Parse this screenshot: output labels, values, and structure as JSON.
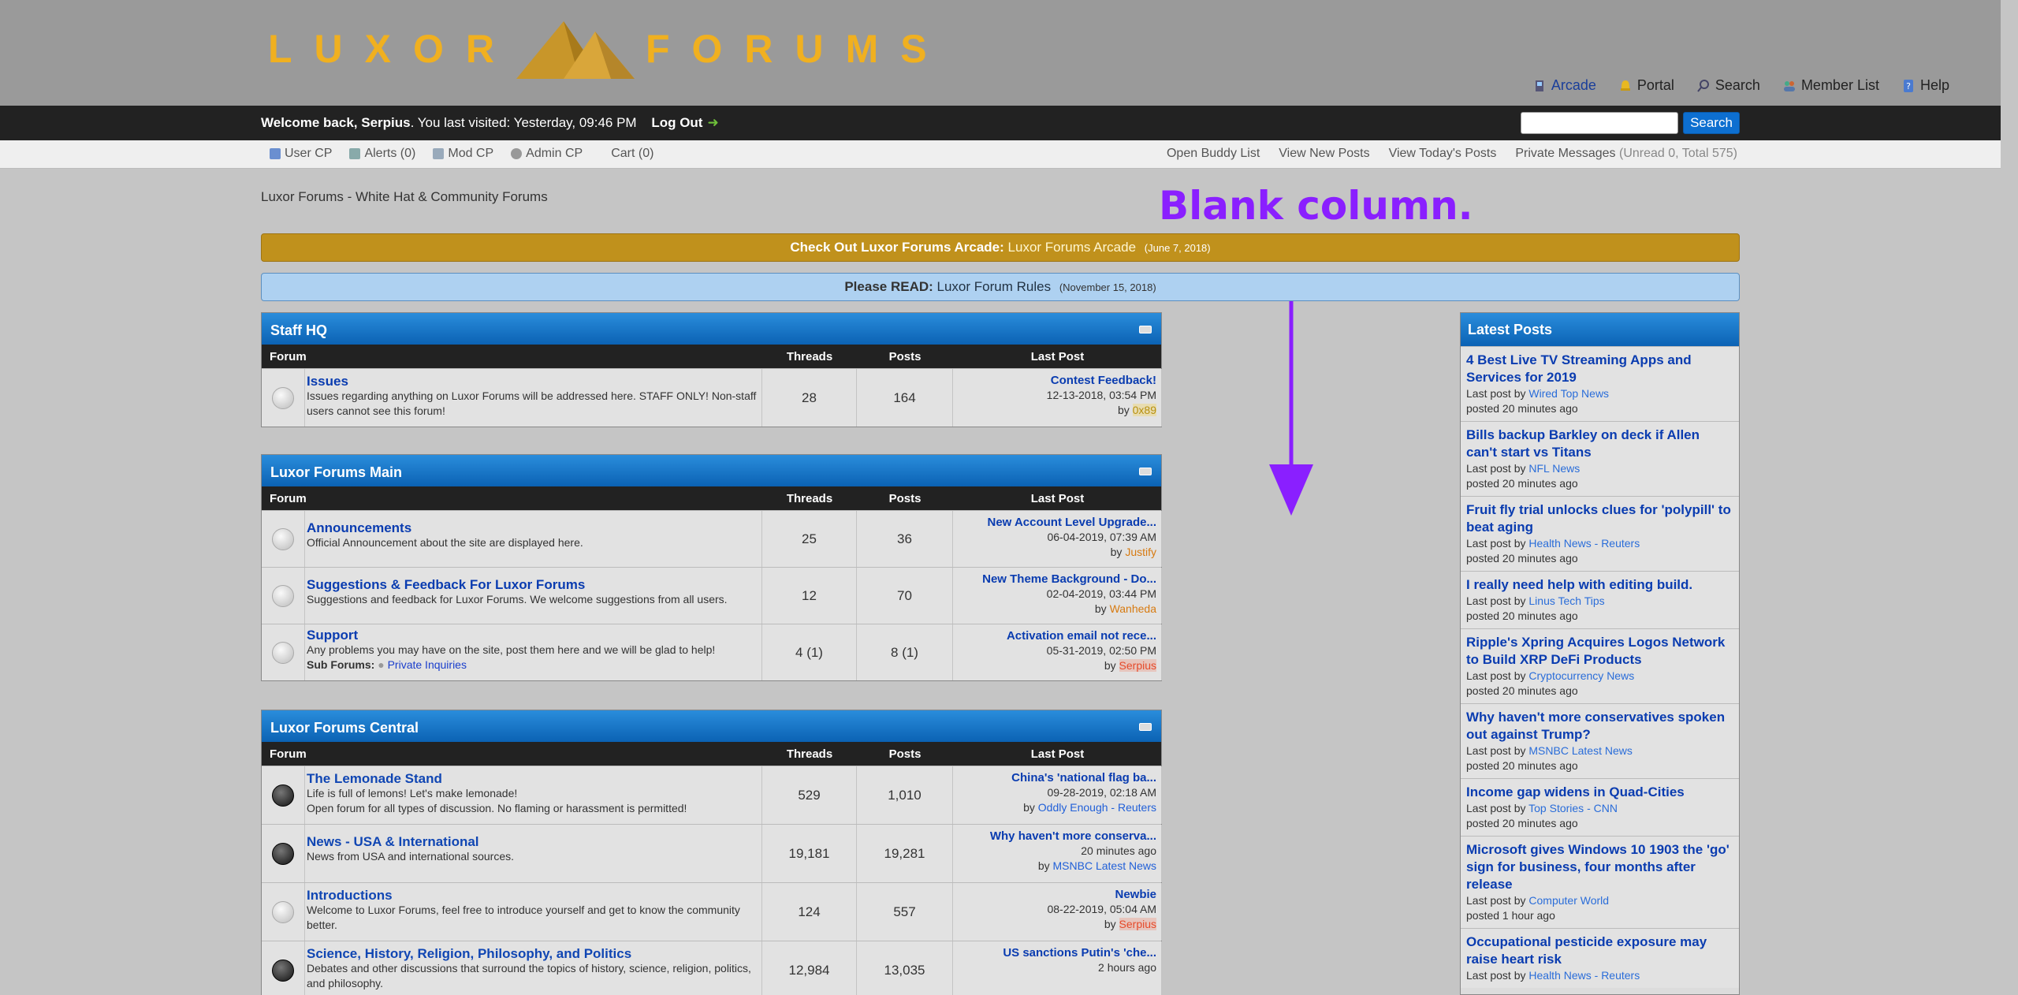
{
  "header": {
    "logo_left": "LUXOR",
    "logo_right": "FORUMS",
    "menu": [
      {
        "label": "Arcade",
        "icon": "arcade-icon"
      },
      {
        "label": "Portal",
        "icon": "portal-icon"
      },
      {
        "label": "Search",
        "icon": "search-icon"
      },
      {
        "label": "Member List",
        "icon": "member-list-icon"
      },
      {
        "label": "Help",
        "icon": "help-icon"
      }
    ]
  },
  "welcome": {
    "prefix": "Welcome back, Serpius",
    "visited": ". You last visited: Yesterday, 09:46 PM",
    "logout": "Log Out",
    "search_button": "Search",
    "search_placeholder": ""
  },
  "userbar": {
    "left": [
      "User CP",
      "Alerts (0)",
      "Mod CP",
      "Admin CP",
      "Cart (0)"
    ],
    "right": [
      "Open Buddy List",
      "View New Posts",
      "View Today's Posts"
    ],
    "pm_label": "Private Messages",
    "pm_count": "(Unread 0, Total 575)"
  },
  "breadcrumb": "Luxor Forums - White Hat & Community Forums",
  "annotation": "Blank column.",
  "announcements": [
    {
      "lead": "Check Out Luxor Forums Arcade:",
      "link": "Luxor Forums Arcade",
      "date": "(June 7, 2018)"
    },
    {
      "lead": "Please READ:",
      "link": "Luxor Forum Rules",
      "date": "(November 15, 2018)"
    }
  ],
  "columns": {
    "forum": "Forum",
    "threads": "Threads",
    "posts": "Posts",
    "last_post": "Last Post"
  },
  "categories": [
    {
      "name": "Staff HQ",
      "forums": [
        {
          "name": "Issues",
          "desc": "Issues regarding anything on Luxor Forums will be addressed here. STAFF ONLY! Non-staff users cannot see this forum!",
          "threads": "28",
          "posts": "164",
          "last_title": "Contest Feedback!",
          "last_date": "12-13-2018, 03:54 PM",
          "last_by": "0x89"
        }
      ]
    },
    {
      "name": "Luxor Forums Main",
      "forums": [
        {
          "name": "Announcements",
          "desc": "Official Announcement about the site are displayed here.",
          "threads": "25",
          "posts": "36",
          "last_title": "New Account Level Upgrade...",
          "last_date": "06-04-2019, 07:39 AM",
          "last_by": "Justify"
        },
        {
          "name": "Suggestions & Feedback For Luxor Forums",
          "desc": "Suggestions and feedback for Luxor Forums. We welcome suggestions from all users.",
          "threads": "12",
          "posts": "70",
          "last_title": "New Theme Background - Do...",
          "last_date": "02-04-2019, 03:44 PM",
          "last_by": "Wanheda"
        },
        {
          "name": "Support",
          "desc": "Any problems you may have on the site, post them here and we will be glad to help!",
          "sub_label": "Sub Forums:",
          "sub_link": "Private Inquiries",
          "threads": "4 (1)",
          "posts": "8 (1)",
          "last_title": "Activation email not rece...",
          "last_date": "05-31-2019, 02:50 PM",
          "last_by": "Serpius"
        }
      ]
    },
    {
      "name": "Luxor Forums Central",
      "forums": [
        {
          "name": "The Lemonade Stand",
          "desc": "Life is full of lemons! Let's make lemonade!",
          "desc2": "Open forum for all types of discussion. No flaming or harassment is permitted!",
          "threads": "529",
          "posts": "1,010",
          "last_title": "China's 'national flag ba...",
          "last_date": "09-28-2019, 02:18 AM",
          "last_by": "Oddly Enough - Reuters"
        },
        {
          "name": "News - USA & International",
          "desc": "News from USA and international sources.",
          "threads": "19,181",
          "posts": "19,281",
          "last_title": "Why haven't more conserva...",
          "last_date": "20 minutes ago",
          "last_by": "MSNBC Latest News"
        },
        {
          "name": "Introductions",
          "desc": "Welcome to Luxor Forums, feel free to introduce yourself and get to know the community better.",
          "threads": "124",
          "posts": "557",
          "last_title": "Newbie",
          "last_date": "08-22-2019, 05:04 AM",
          "last_by": "Serpius"
        },
        {
          "name": "Science, History, Religion, Philosophy, and Politics",
          "desc": "Debates and other discussions that surround the topics of history, science, religion, politics, and philosophy.",
          "threads": "12,984",
          "posts": "13,035",
          "last_title": "US sanctions Putin's 'che...",
          "last_date": "2 hours ago",
          "last_by": ""
        }
      ]
    }
  ],
  "latest": {
    "title": "Latest Posts",
    "last_post_label": "Last post by",
    "posts": [
      {
        "title": "4 Best Live TV Streaming Apps and Services for 2019",
        "by": "Wired Top News",
        "when": "posted 20 minutes ago"
      },
      {
        "title": "Bills backup Barkley on deck if Allen can't start vs Titans",
        "by": "NFL News",
        "when": "posted 20 minutes ago"
      },
      {
        "title": "Fruit fly trial unlocks clues for 'polypill' to beat aging",
        "by": "Health News - Reuters",
        "when": "posted 20 minutes ago"
      },
      {
        "title": "I really need help with editing build.",
        "by": "Linus Tech Tips",
        "when": "posted 20 minutes ago"
      },
      {
        "title": "Ripple's Xpring Acquires Logos Network to Build XRP DeFi Products",
        "by": "Cryptocurrency News",
        "when": "posted 20 minutes ago"
      },
      {
        "title": "Why haven't more conservatives spoken out against Trump?",
        "by": "MSNBC Latest News",
        "when": "posted 20 minutes ago"
      },
      {
        "title": "Income gap widens in Quad-Cities",
        "by": "Top Stories - CNN",
        "when": "posted 20 minutes ago"
      },
      {
        "title": "Microsoft gives Windows 10 1903 the 'go' sign for business, four months after release",
        "by": "Computer World",
        "when": "posted 1 hour ago"
      },
      {
        "title": "Occupational pesticide exposure may raise heart risk",
        "by": "Health News - Reuters",
        "when": ""
      }
    ]
  },
  "colors": {
    "accent": "#0b62b4",
    "gold": "#c0911c",
    "logo": "#f0b020",
    "annotation": "#8a1fff"
  }
}
